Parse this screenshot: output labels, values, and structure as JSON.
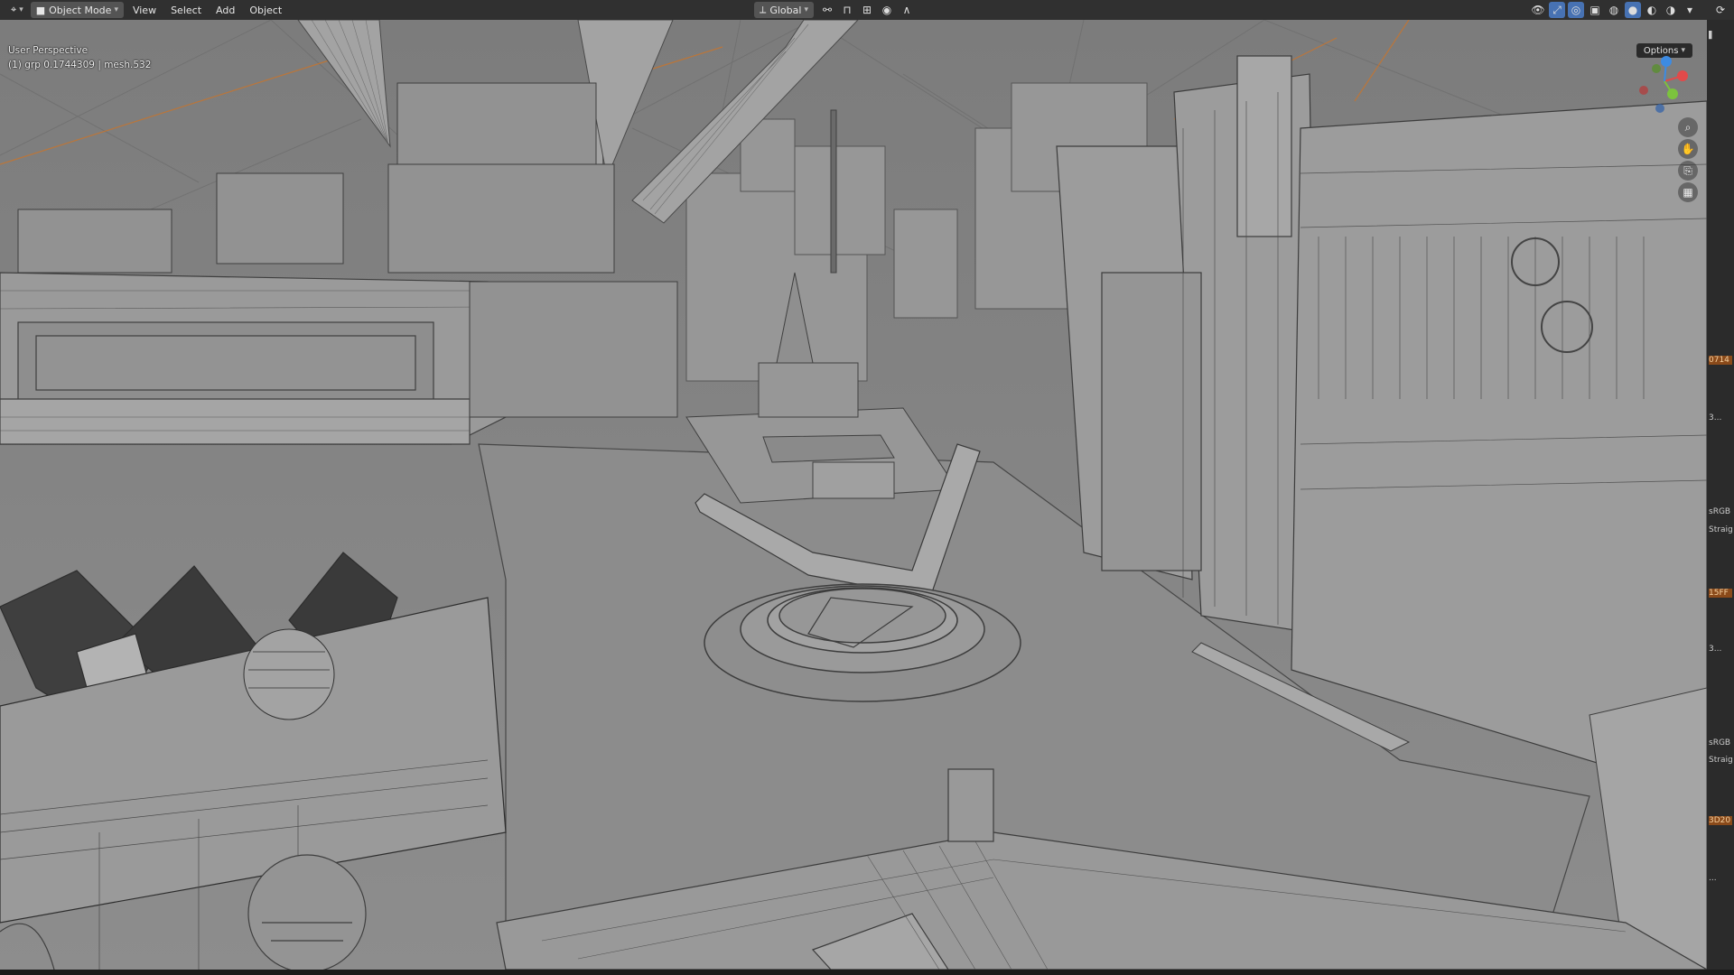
{
  "header": {
    "mode": "Object Mode",
    "menus": [
      "View",
      "Select",
      "Add",
      "Object"
    ],
    "transform_orientation": "Global",
    "options_label": "Options"
  },
  "viewport": {
    "view_name": "User Perspective",
    "stats": "(1) grp 0.1744309 | mesh.532"
  },
  "nav_gizmo": {
    "axes": [
      "X",
      "Y",
      "Z"
    ],
    "colors": {
      "x": "#e24a4a",
      "y": "#7cc33d",
      "z": "#3d8be2"
    }
  },
  "side_panel": {
    "tabs": [
      "0714",
      "3...",
      "sRGB",
      "Straigh",
      "15FF",
      "3...",
      "sRGB",
      "Straigh",
      "3D20",
      "..."
    ]
  },
  "icons": {
    "editor_type": "3d-viewport-icon",
    "zoom": "zoom-icon",
    "pan": "hand-icon",
    "camera": "camera-icon",
    "grid": "grid-icon"
  }
}
